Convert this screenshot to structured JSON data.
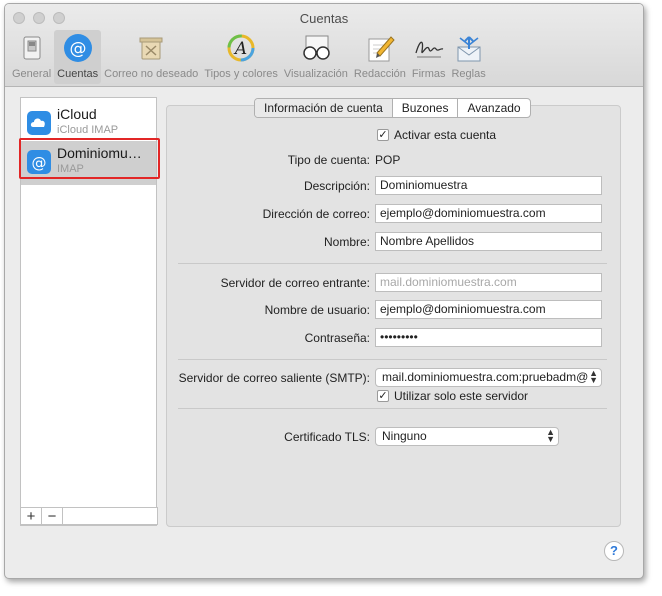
{
  "window": {
    "title": "Cuentas"
  },
  "toolbar": {
    "items": [
      {
        "label": "General",
        "icon": "general-switch-icon"
      },
      {
        "label": "Cuentas",
        "icon": "at-sign-icon",
        "active": true
      },
      {
        "label": "Correo no deseado",
        "icon": "trash-bin-icon"
      },
      {
        "label": "Tipos y colores",
        "icon": "font-colors-icon"
      },
      {
        "label": "Visualización",
        "icon": "glasses-icon"
      },
      {
        "label": "Redacción",
        "icon": "pencil-paper-icon"
      },
      {
        "label": "Firmas",
        "icon": "signature-icon"
      },
      {
        "label": "Reglas",
        "icon": "envelope-arrows-icon"
      }
    ]
  },
  "sidebar": {
    "accounts": [
      {
        "name": "iCloud",
        "type": "iCloud IMAP",
        "icon": "cloud-icon"
      },
      {
        "name": "Dominiomu…",
        "type": "IMAP",
        "icon": "at-sign-icon",
        "selected": true
      }
    ],
    "add_label": "+",
    "remove_label": "−"
  },
  "tabs": [
    "Información de cuenta",
    "Buzones",
    "Avanzado"
  ],
  "form": {
    "enable_label": "Activar esta cuenta",
    "enable_checked": "✓",
    "account_type_label": "Tipo de cuenta:",
    "account_type_value": "POP",
    "description_label": "Descripción:",
    "description_value": "Dominiomuestra",
    "email_label": "Dirección de correo:",
    "email_value": "ejemplo@dominiomuestra.com",
    "name_label": "Nombre:",
    "name_value": "Nombre Apellidos",
    "incoming_label": "Servidor de correo entrante:",
    "incoming_value": "mail.dominiomuestra.com",
    "username_label": "Nombre de usuario:",
    "username_value": "ejemplo@dominiomuestra.com",
    "password_label": "Contraseña:",
    "password_value": "•••••••••",
    "outgoing_label": "Servidor de correo saliente (SMTP):",
    "outgoing_value": "mail.dominiomuestra.com:pruebadm@",
    "only_server_label": "Utilizar solo este servidor",
    "only_server_checked": "✓",
    "tls_label": "Certificado TLS:",
    "tls_value": "Ninguno"
  },
  "help_label": "?",
  "colors": {
    "accent": "#2f7ad9",
    "highlight": "#e22626"
  }
}
